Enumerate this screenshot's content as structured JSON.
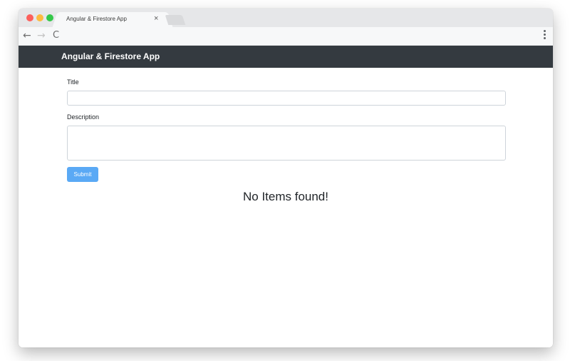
{
  "browser": {
    "tab_title": "Angular & Firestore App",
    "tab_close": "×",
    "nav_back": "←",
    "nav_forward": "→",
    "nav_reload": "C"
  },
  "navbar": {
    "brand": "Angular & Firestore App",
    "background_color": "#343a40"
  },
  "form": {
    "title_label": "Title",
    "title_value": "",
    "description_label": "Description",
    "description_value": "",
    "submit_label": "Submit",
    "submit_color": "#5aa9f5"
  },
  "items": {
    "empty_message": "No Items found!"
  }
}
